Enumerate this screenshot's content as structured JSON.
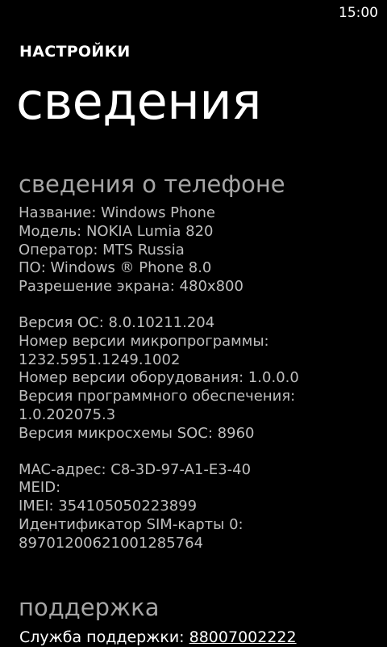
{
  "status_bar": {
    "time": "15:00"
  },
  "header": {
    "app_title": "НАСТРОЙКИ",
    "page_title": "сведения"
  },
  "about": {
    "title": "сведения о телефоне",
    "groups": [
      {
        "lines": [
          "Название: Windows Phone",
          "Модель: NOKIA Lumia 820",
          "Оператор: MTS Russia",
          "ПО: Windows ® Phone 8.0",
          "Разрешение экрана: 480x800"
        ]
      },
      {
        "lines": [
          "Версия ОС: 8.0.10211.204",
          "Номер версии микропрограммы:",
          "1232.5951.1249.1002",
          "Номер версии оборудования: 1.0.0.0",
          "Версия программного обеспечения:",
          "1.0.202075.3",
          "Версия микросхемы SOC: 8960"
        ]
      },
      {
        "lines": [
          "MAC-адрес: C8-3D-97-A1-E3-40",
          "MEID:",
          "IMEI: 354105050223899",
          "Идентификатор SIM-карты 0:",
          "89701200621001285764"
        ]
      }
    ]
  },
  "support": {
    "title": "поддержка",
    "label": "Служба поддержки: ",
    "phone": "88007002222"
  }
}
